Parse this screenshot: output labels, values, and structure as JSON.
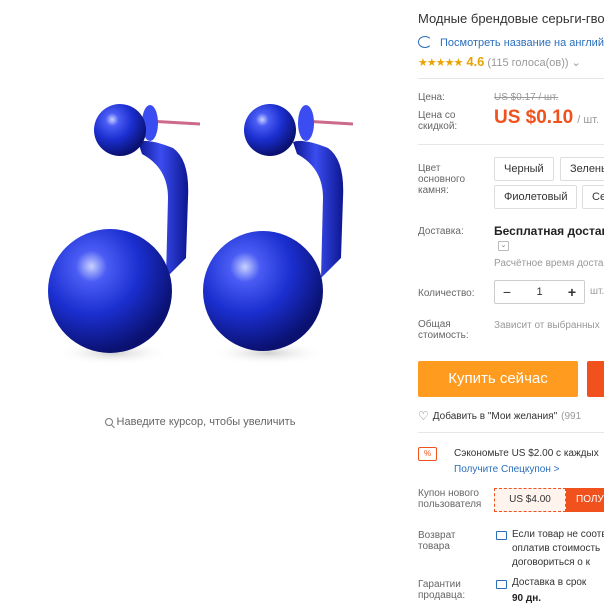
{
  "product": {
    "title": "Модные брендовые серьги-гвозди",
    "translate_link": "Посмотреть название на английском",
    "rating": {
      "stars": "★★★★★",
      "value": "4.6",
      "count": "(115 голоса(ов))",
      "chevron": "⌄"
    },
    "zoom_hint": "Наведите курсор, чтобы увеличить"
  },
  "pricing": {
    "price_label": "Цена:",
    "old_price": "US $0.17 / шт.",
    "discount_label": "Цена со скидкой:",
    "new_price": "US $0.10",
    "unit": "/ шт."
  },
  "options": {
    "color_label": "Цвет основного камня:",
    "colors": [
      "Черный",
      "Зеленый",
      "Фиолетовый",
      "Се"
    ]
  },
  "shipping": {
    "label": "Доставка:",
    "value": "Бесплатная доставка",
    "dropdown_icon": "⌄",
    "time": "Расчётное время доставки"
  },
  "quantity": {
    "label": "Количество:",
    "minus": "−",
    "value": "1",
    "plus": "+",
    "available": "шт."
  },
  "total": {
    "label": "Общая стоимость:",
    "value": "Зависит от выбранных"
  },
  "actions": {
    "buy_now": "Купить сейчас",
    "wishlist": "Добавить в \"Мои желания\"",
    "wishlist_count": "(991"
  },
  "coupon": {
    "icon": "%",
    "save_text": "Сэкономьте US $2.00 с каждых",
    "special_link": "Получите Спецкупон >",
    "new_user_label": "Купон нового пользователя",
    "amount": "US $4.00",
    "get_label": "ПОЛУЧИТЬ"
  },
  "returns": {
    "label": "Возврат товара",
    "text_lines": [
      "Если товар не соответствует",
      "оплатив стоимость",
      "договориться о к"
    ]
  },
  "guarantee": {
    "label": "Гарантии продавца:",
    "text": "Доставка в срок",
    "days": "90 дн."
  },
  "colors": {
    "accent_orange": "#f0511d",
    "buy_button": "#ff9b1f",
    "link_blue": "#2a6ebb",
    "star_gold": "#e8a400",
    "product_blue": "#1628c8"
  }
}
